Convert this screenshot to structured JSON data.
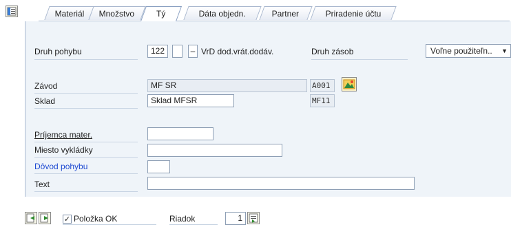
{
  "tabs": [
    "Materiál",
    "Množstvo",
    "Tý",
    "Dáta objedn.",
    "Partner",
    "Priradenie účtu"
  ],
  "movement": {
    "druh_pohybu_label": "Druh pohybu",
    "druh_pohybu_value": "122",
    "special_value": "",
    "reason_code": "–",
    "movement_text": "VrD dod.vrát.dodáv.",
    "druh_zasob_label": "Druh zásob",
    "druh_zasob_value": "Voľne použiteľn.."
  },
  "plant": {
    "zavod_label": "Závod",
    "zavod_name": "MF SR",
    "zavod_code": "A001",
    "sklad_label": "Sklad",
    "sklad_name": "Sklad MFSR",
    "sklad_code": "MF11"
  },
  "recipient": {
    "prijemca_label": "Príjemca mater.",
    "prijemca_value": "",
    "miesto_label": "Miesto vykládky",
    "miesto_value": "",
    "dovod_label": "Dôvod pohybu",
    "dovod_value": "",
    "text_label": "Text",
    "text_value": ""
  },
  "footer": {
    "polozka_ok_label": "Položka OK",
    "polozka_ok_checked": true,
    "riadok_label": "Riadok",
    "riadok_value": "1"
  },
  "colors": {
    "tab_border": "#a9b8cf",
    "panel_bg": "#eff4f9",
    "required_label": "#1f4bd2"
  }
}
